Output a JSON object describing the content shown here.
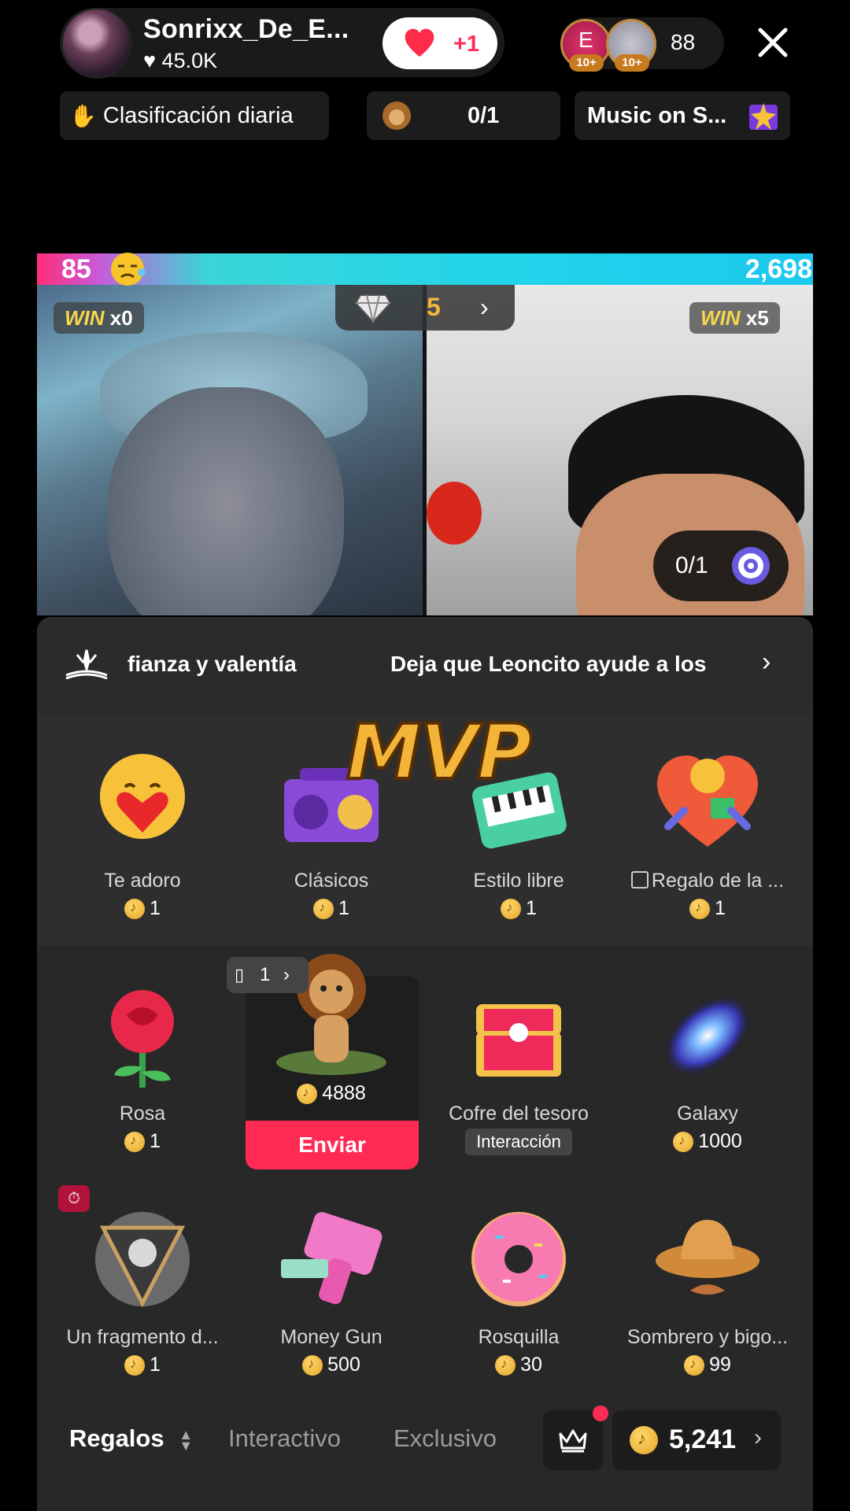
{
  "header": {
    "host_name": "Sonrixx_De_E...",
    "host_likes": "45.0K",
    "like_button_label": "+1",
    "viewer_badges": [
      "10+",
      "10+"
    ],
    "viewer_count": "88"
  },
  "chips": {
    "ranking": "Clasificación diaria",
    "task_progress": "0/1",
    "music": "Music on S..."
  },
  "battle": {
    "left_score": "85",
    "right_score": "2,698",
    "left_win_label": "WIN",
    "left_win_count": "x0",
    "right_win_label": "WIN",
    "right_win_count": "x5",
    "center_value": "5",
    "task_progress": "0/1"
  },
  "marquee": {
    "text_1": "fianza y valentía",
    "text_2": "Deja que Leoncito ayude a los",
    "overlay_badge": "MVP"
  },
  "gifts": [
    {
      "name": "Te adoro",
      "price": "1"
    },
    {
      "name": "Clásicos",
      "price": "1"
    },
    {
      "name": "Estilo libre",
      "price": "1"
    },
    {
      "name": "Regalo de la ...",
      "price": "1",
      "locked": true
    },
    {
      "name": "Rosa",
      "price": "1"
    },
    {
      "name": "",
      "price": "4888",
      "selected": true,
      "action": "Enviar",
      "count": "1"
    },
    {
      "name": "Cofre del tesoro",
      "tag": "Interacción"
    },
    {
      "name": "Galaxy",
      "price": "1000"
    },
    {
      "name": "Un fragmento d...",
      "price": "1"
    },
    {
      "name": "Money Gun",
      "price": "500"
    },
    {
      "name": "Rosquilla",
      "price": "30"
    },
    {
      "name": "Sombrero y bigo...",
      "price": "99"
    }
  ],
  "tabs": {
    "regalos": "Regalos",
    "interactivo": "Interactivo",
    "exclusivo": "Exclusivo"
  },
  "balance": "5,241",
  "colors": {
    "accent": "#ff2b55",
    "coin": "#f2b53a",
    "score_bar_left": "#ff2d7a",
    "score_bar_right": "#1cc8ee"
  },
  "icons": [
    "heart-icon",
    "close-icon",
    "fire-hand-icon",
    "lion-icon",
    "music-gift-icon",
    "crown-icon",
    "coin-icon",
    "diamond-icon",
    "target-icon",
    "sparkle-book-icon",
    "chevron-right-icon",
    "timer-icon",
    "sort-icon"
  ]
}
